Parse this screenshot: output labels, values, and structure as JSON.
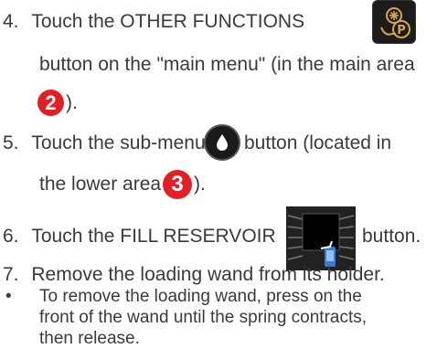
{
  "steps": [
    {
      "number": "4.",
      "before": "Touch the OTHER FUNCTIONS",
      "cont1": "button on the \"main menu\" (in the main area",
      "badge": "2",
      "after": ")."
    },
    {
      "number": "5.",
      "before": "Touch the sub-menu",
      "after_icon": "button (located in",
      "cont1": "the lower area",
      "badge": "3",
      "after": ")."
    },
    {
      "number": "6.",
      "before": "Touch the FILL RESERVOIR",
      "after_icon": "button."
    },
    {
      "number": "7.",
      "text": "Remove the loading wand from its holder."
    }
  ],
  "bullet": {
    "symbol": "•",
    "lines": [
      "To remove the loading wand, press on the",
      "front of the wand until the spring contracts,",
      "then release."
    ]
  },
  "colors": {
    "text": "#3a3a3a",
    "badge": "#e31e24",
    "gold": "#d8a64a"
  },
  "icons": {
    "other_functions": "other-functions-icon",
    "drop": "water-drop-icon",
    "fill_reservoir": "fill-reservoir-icon"
  }
}
